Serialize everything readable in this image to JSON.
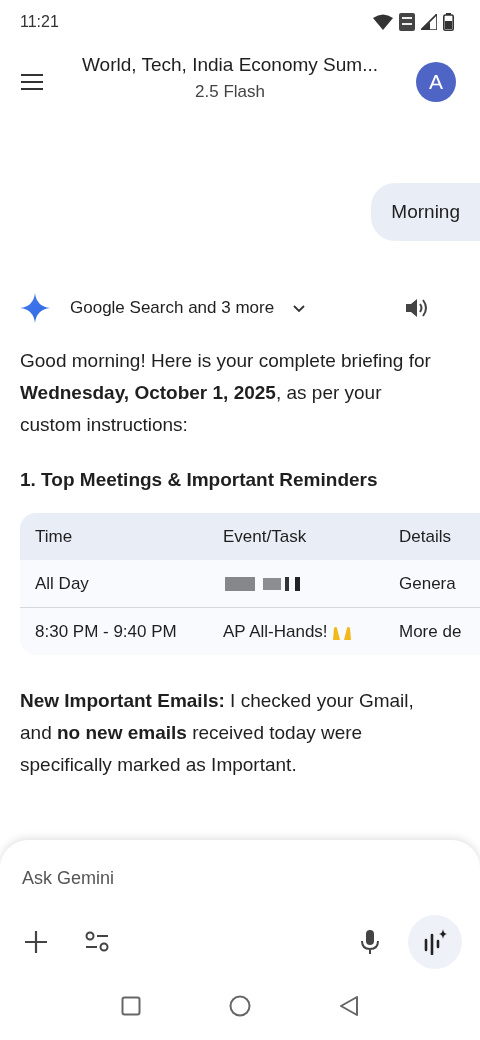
{
  "status_bar": {
    "time": "11:21"
  },
  "header": {
    "title": "World, Tech, India Economy Sum...",
    "model": "2.5 Flash",
    "avatar": "A"
  },
  "user_message": "Morning",
  "response": {
    "sources": "Google Search and 3 more",
    "sources_expanded": false,
    "intro": "Good morning! Here is your complete briefing for **Wednesday, October 1, 2025**, as per your custom instructions:",
    "heading": "1. Top Meetings & Important Reminders",
    "table": {
      "columns": [
        "Time",
        "Event/Task",
        "Details"
      ],
      "rows": [
        {
          "time": "All Day",
          "event": {
            "kind": "redacted"
          },
          "details": "Genera"
        },
        {
          "time": "8:30 PM - 9:40 PM",
          "event": {
            "kind": "text",
            "text": "AP All-Hands!",
            "emoji": true
          },
          "details": "More de"
        }
      ]
    },
    "emails": "**New Important Emails:** I checked your Gmail, and **no new emails** received today were specifically marked as Important."
  },
  "input": {
    "placeholder": "Ask Gemini"
  }
}
